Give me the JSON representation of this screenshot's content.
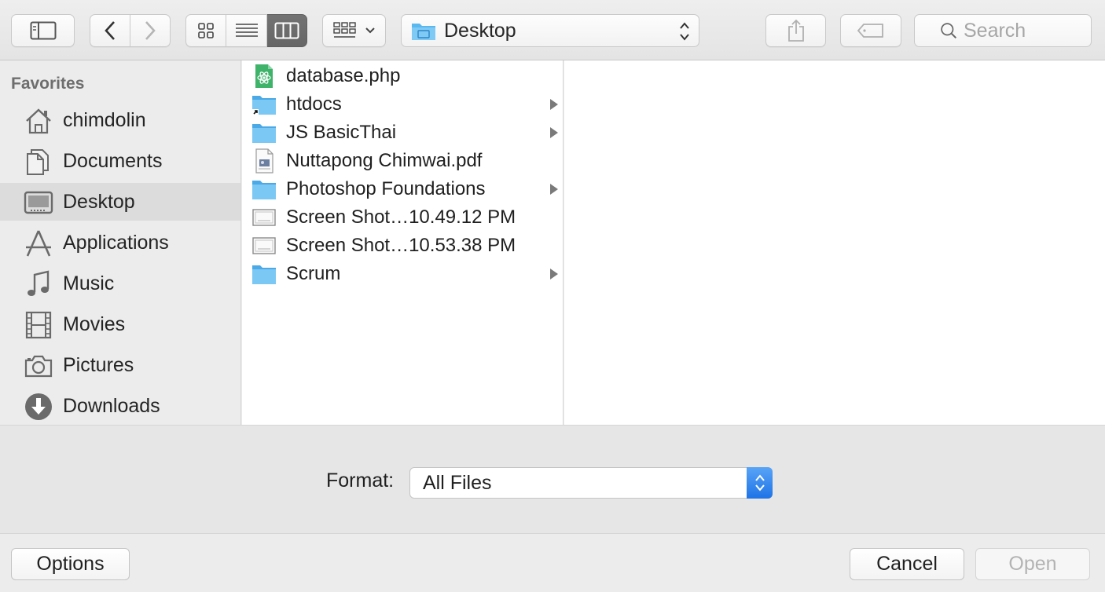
{
  "toolbar": {
    "location_label": "Desktop",
    "search_placeholder": "Search"
  },
  "sidebar": {
    "heading": "Favorites",
    "items": [
      {
        "label": "chimdolin",
        "icon": "home-icon",
        "selected": false
      },
      {
        "label": "Documents",
        "icon": "documents-icon",
        "selected": false
      },
      {
        "label": "Desktop",
        "icon": "desktop-icon",
        "selected": true
      },
      {
        "label": "Applications",
        "icon": "applications-icon",
        "selected": false
      },
      {
        "label": "Music",
        "icon": "music-note-icon",
        "selected": false
      },
      {
        "label": "Movies",
        "icon": "film-strip-icon",
        "selected": false
      },
      {
        "label": "Pictures",
        "icon": "camera-icon",
        "selected": false
      },
      {
        "label": "Downloads",
        "icon": "download-arrow-icon",
        "selected": false
      }
    ]
  },
  "files": [
    {
      "name": "database.php",
      "icon": "atom-file-icon",
      "folder": false
    },
    {
      "name": "htdocs",
      "icon": "folder-alias-icon",
      "folder": true
    },
    {
      "name": "JS BasicThai",
      "icon": "folder-icon",
      "folder": true
    },
    {
      "name": "Nuttapong Chimwai.pdf",
      "icon": "pdf-file-icon",
      "folder": false
    },
    {
      "name": "Photoshop Foundations",
      "icon": "folder-icon",
      "folder": true
    },
    {
      "name": "Screen Shot…10.49.12 PM",
      "icon": "screenshot-file-icon",
      "folder": false
    },
    {
      "name": "Screen Shot…10.53.38 PM",
      "icon": "screenshot-file-icon",
      "folder": false
    },
    {
      "name": "Scrum",
      "icon": "folder-icon",
      "folder": true
    }
  ],
  "format": {
    "label": "Format:",
    "selected": "All Files"
  },
  "buttons": {
    "options": "Options",
    "cancel": "Cancel",
    "open": "Open"
  },
  "colors": {
    "folder_blue": "#5ab8f0",
    "accent_blue": "#1f73e6"
  }
}
